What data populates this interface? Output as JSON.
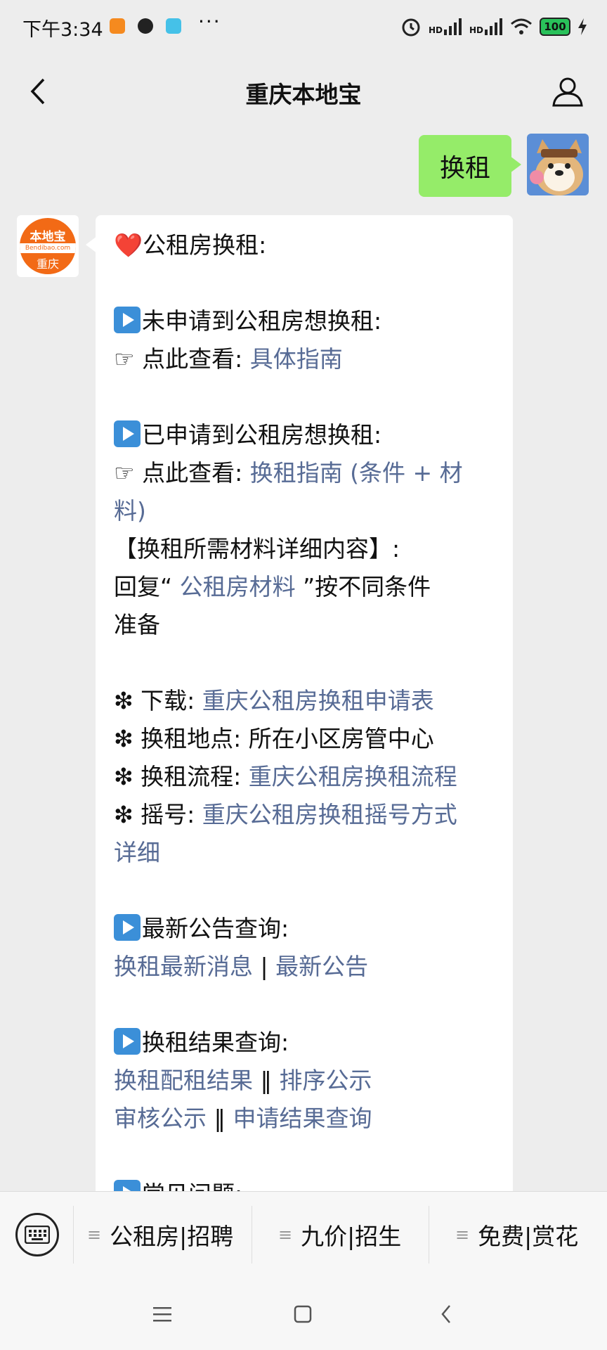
{
  "status_bar": {
    "time": "下午3:34",
    "signal1": "HD",
    "signal2": "HD",
    "battery": "100",
    "more": "···"
  },
  "header": {
    "title": "重庆本地宝"
  },
  "chat": {
    "my_message": "换租",
    "bot_avatar": {
      "logo_top": "本地宝",
      "logo_mid": "Bendibao.com",
      "logo_bottom": "重庆"
    },
    "reply": {
      "heading": "公租房换租:",
      "s1_title": "未申请到公租房想换租:",
      "s1_prefix": "☞ 点此查看: ",
      "s1_link": "具体指南",
      "s2_title": "已申请到公租房想换租:",
      "s2_prefix": "☞ 点此查看: ",
      "s2_link_line1": "换租指南 (条件 + 材",
      "s2_link_line2": "料)",
      "materials_title": "【换租所需材料详细内容】:",
      "reply_prefix": "回复“ ",
      "reply_link": "公租房材料",
      "reply_suffix": " ”按不同条件",
      "reply_line2": "准备",
      "download_prefix": "❇ 下载: ",
      "download_link": "重庆公租房换租申请表",
      "location_text": "❇ 换租地点: 所在小区房管中心",
      "process_prefix": "❇ 换租流程: ",
      "process_link": "重庆公租房换租流程",
      "lottery_prefix": "❇ 摇号: ",
      "lottery_link_line1": "重庆公租房换租摇号方式",
      "lottery_link_line2": "详细",
      "news_title": "最新公告查询:",
      "news_link1": "换租最新消息",
      "news_sep": " | ",
      "news_link2": "最新公告",
      "results_title": "换租结果查询:",
      "result_link1": "换租配租结果",
      "result_sep": "  ‖  ",
      "result_link2": "排序公示",
      "result_link3": "审核公示",
      "result_link4": "申请结果查询",
      "faq_title": "常见问题:"
    }
  },
  "bottom_menu": {
    "items": [
      {
        "label": "公租房|招聘"
      },
      {
        "label": "九价|招生"
      },
      {
        "label": "免费|赏花"
      }
    ],
    "menu_icon": "≡"
  }
}
